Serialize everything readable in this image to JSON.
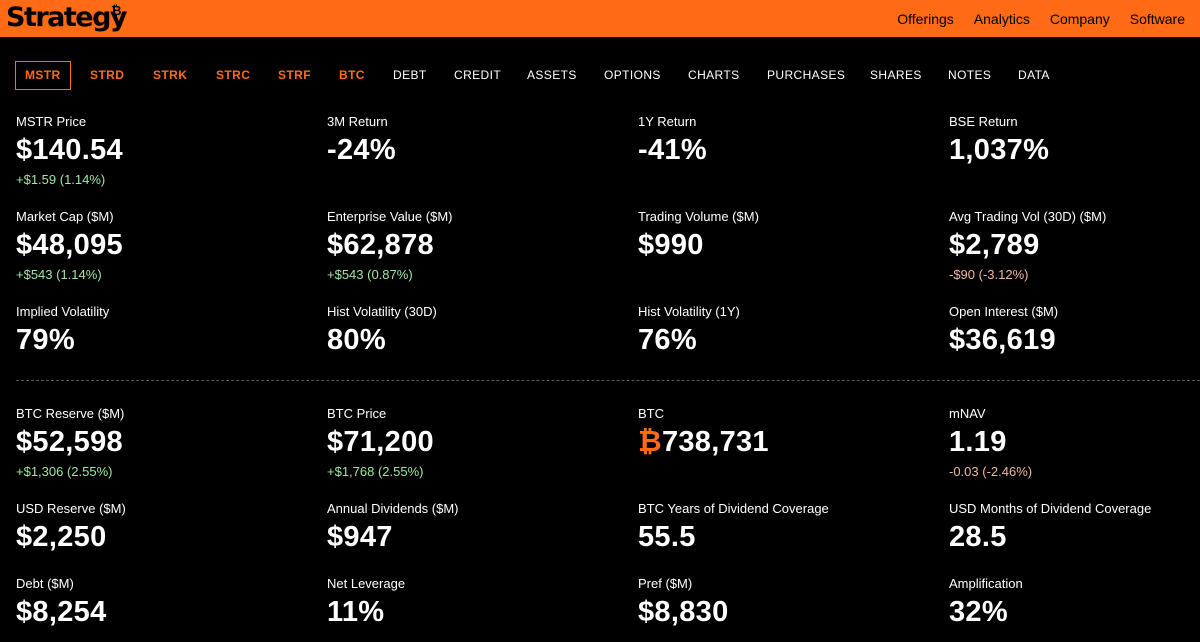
{
  "header": {
    "logo_text": "Strategy",
    "logo_mark": "₿",
    "nav": [
      "Offerings",
      "Analytics",
      "Company",
      "Software"
    ]
  },
  "tabs": [
    {
      "label": "MSTR"
    },
    {
      "label": "STRD"
    },
    {
      "label": "STRK"
    },
    {
      "label": "STRC"
    },
    {
      "label": "STRF"
    },
    {
      "label": "BTC"
    },
    {
      "label": "DEBT"
    },
    {
      "label": "CREDIT"
    },
    {
      "label": "ASSETS"
    },
    {
      "label": "OPTIONS"
    },
    {
      "label": "CHARTS"
    },
    {
      "label": "PURCHASES"
    },
    {
      "label": "SHARES"
    },
    {
      "label": "NOTES"
    },
    {
      "label": "DATA"
    }
  ],
  "active_tab": "MSTR",
  "metrics": {
    "mstr_price": {
      "label": "MSTR Price",
      "value": "$140.54",
      "change": "+$1.59 (1.14%)"
    },
    "return_3m": {
      "label": "3M Return",
      "value": "-24%"
    },
    "return_1y": {
      "label": "1Y Return",
      "value": "-41%"
    },
    "bse_return": {
      "label": "BSE Return",
      "value": "1,037%"
    },
    "market_cap": {
      "label": "Market Cap ($M)",
      "value": "$48,095",
      "change": "+$543 (1.14%)"
    },
    "enterprise_value": {
      "label": "Enterprise Value ($M)",
      "value": "$62,878",
      "change": "+$543 (0.87%)"
    },
    "trading_volume": {
      "label": "Trading Volume ($M)",
      "value": "$990"
    },
    "avg_trading_vol": {
      "label": "Avg Trading Vol (30D) ($M)",
      "value": "$2,789",
      "change": "-$90 (-3.12%)"
    },
    "implied_volatility": {
      "label": "Implied Volatility",
      "value": "79%"
    },
    "hist_vol_30d": {
      "label": "Hist Volatility (30D)",
      "value": "80%"
    },
    "hist_vol_1y": {
      "label": "Hist Volatility (1Y)",
      "value": "76%"
    },
    "open_interest": {
      "label": "Open Interest ($M)",
      "value": "$36,619"
    },
    "btc_reserve": {
      "label": "BTC Reserve ($M)",
      "value": "$52,598",
      "change": "+$1,306 (2.55%)"
    },
    "btc_price": {
      "label": "BTC Price",
      "value": "$71,200",
      "change": "+$1,768 (2.55%)"
    },
    "btc": {
      "label": "BTC",
      "symbol": "₿",
      "value": "738,731"
    },
    "mnav": {
      "label": "mNAV",
      "value": "1.19",
      "change": "-0.03 (-2.46%)"
    },
    "usd_reserve": {
      "label": "USD Reserve ($M)",
      "value": "$2,250"
    },
    "annual_dividends": {
      "label": "Annual Dividends ($M)",
      "value": "$947"
    },
    "btc_years_coverage": {
      "label": "BTC Years of Dividend Coverage",
      "value": "55.5"
    },
    "usd_months_coverage": {
      "label": "USD Months of Dividend Coverage",
      "value": "28.5"
    },
    "debt": {
      "label": "Debt ($M)",
      "value": "$8,254"
    },
    "net_leverage": {
      "label": "Net Leverage",
      "value": "11%"
    },
    "pref": {
      "label": "Pref ($M)",
      "value": "$8,830"
    },
    "amplification": {
      "label": "Amplification",
      "value": "32%"
    }
  },
  "colors": {
    "accent": "#ff6a14",
    "background": "#000000",
    "positive": "#9be7a3",
    "negative": "#f2b8a0"
  }
}
